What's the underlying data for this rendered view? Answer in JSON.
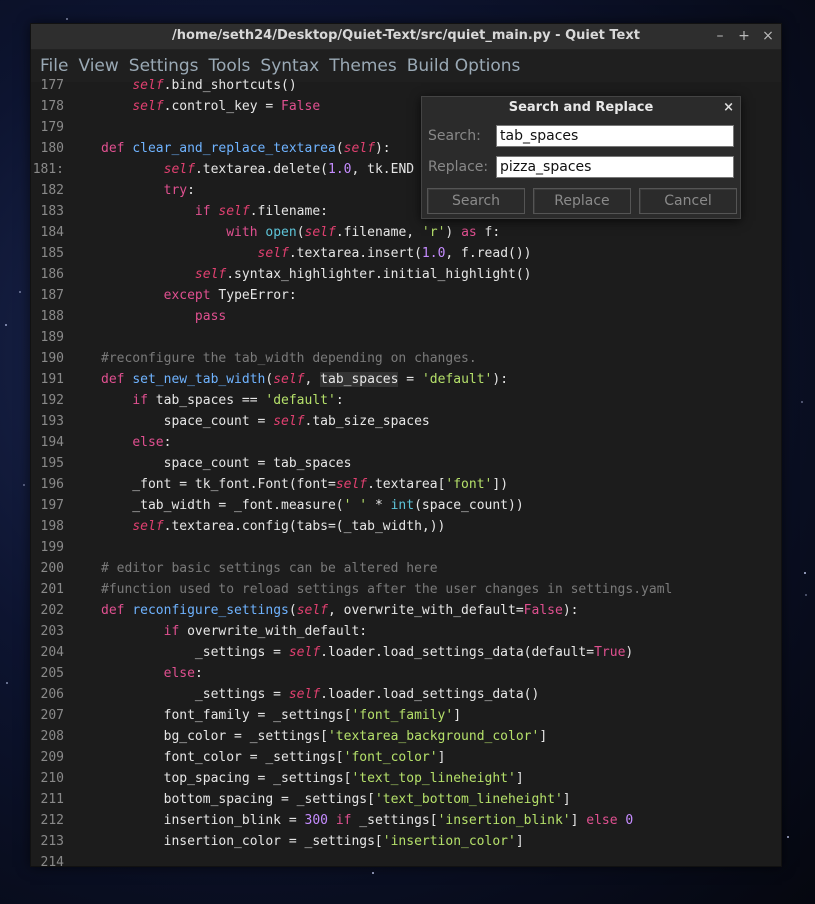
{
  "window": {
    "title": "/home/seth24/Desktop/Quiet-Text/src/quiet_main.py - Quiet Text",
    "minimize": "–",
    "maximize": "+",
    "close": "×"
  },
  "menu": [
    "File",
    "View",
    "Settings",
    "Tools",
    "Syntax",
    "Themes",
    "Build Options"
  ],
  "dialog": {
    "title": "Search and Replace",
    "close": "×",
    "search_label": "Search:",
    "search_value": "tab_spaces",
    "replace_label": "Replace:",
    "replace_value": "pizza_spaces",
    "buttons": [
      "Search",
      "Replace",
      "Cancel"
    ]
  },
  "lines": [
    {
      "n": "177",
      "html": "        <span class=\"self\">self</span>.bind_shortcuts()"
    },
    {
      "n": "178",
      "html": "        <span class=\"self\">self</span>.control_key = <span class=\"kw\">False</span>"
    },
    {
      "n": "179",
      "html": ""
    },
    {
      "n": "180",
      "html": "    <span class=\"kw\">def</span> <span class=\"fn\">clear_and_replace_textarea</span>(<span class=\"self\">self</span>):"
    },
    {
      "n": "181:",
      "html": "            <span class=\"self\">self</span>.textarea.delete(<span class=\"num\">1.0</span>, tk.END"
    },
    {
      "n": "182",
      "html": "            <span class=\"kw\">try</span>:"
    },
    {
      "n": "183",
      "html": "                <span class=\"kw\">if</span> <span class=\"self\">self</span>.filename:"
    },
    {
      "n": "184",
      "html": "                    <span class=\"kw\">with</span> <span class=\"bi\">open</span>(<span class=\"self\">self</span>.filename, <span class=\"str\">'r'</span>) <span class=\"kw\">as</span> f:"
    },
    {
      "n": "185",
      "html": "                        <span class=\"self\">self</span>.textarea.insert(<span class=\"num\">1.0</span>, f.read())"
    },
    {
      "n": "186",
      "html": "                <span class=\"self\">self</span>.syntax_highlighter.initial_highlight()"
    },
    {
      "n": "187",
      "html": "            <span class=\"kw\">except</span> TypeError:"
    },
    {
      "n": "188",
      "html": "                <span class=\"kw\">pass</span>"
    },
    {
      "n": "189",
      "html": ""
    },
    {
      "n": "190",
      "html": "    <span class=\"cm\">#reconfigure the tab_width depending on changes.</span>"
    },
    {
      "n": "191",
      "html": "    <span class=\"kw\">def</span> <span class=\"fn\">set_new_tab_width</span>(<span class=\"self\">self</span>, <span class=\"hl\">tab_spaces</span> = <span class=\"str\">'default'</span>):"
    },
    {
      "n": "192",
      "html": "        <span class=\"kw\">if</span> tab_spaces == <span class=\"str\">'default'</span>:"
    },
    {
      "n": "193",
      "html": "            space_count = <span class=\"self\">self</span>.tab_size_spaces"
    },
    {
      "n": "194",
      "html": "        <span class=\"kw\">else</span>:"
    },
    {
      "n": "195",
      "html": "            space_count = tab_spaces"
    },
    {
      "n": "196",
      "html": "        _font = tk_font.Font(font=<span class=\"self\">self</span>.textarea[<span class=\"str\">'font'</span>])"
    },
    {
      "n": "197",
      "html": "        _tab_width = _font.measure(<span class=\"str\">' '</span> * <span class=\"bi\">int</span>(space_count))"
    },
    {
      "n": "198",
      "html": "        <span class=\"self\">self</span>.textarea.config(tabs=(_tab_width,))"
    },
    {
      "n": "199",
      "html": ""
    },
    {
      "n": "200",
      "html": "    <span class=\"cm\"># editor basic settings can be altered here</span>"
    },
    {
      "n": "201",
      "html": "    <span class=\"cm\">#function used to reload settings after the user changes in settings.yaml</span>"
    },
    {
      "n": "202",
      "html": "    <span class=\"kw\">def</span> <span class=\"fn\">reconfigure_settings</span>(<span class=\"self\">self</span>, overwrite_with_default=<span class=\"kw\">False</span>):"
    },
    {
      "n": "203",
      "html": "            <span class=\"kw\">if</span> overwrite_with_default:"
    },
    {
      "n": "204",
      "html": "                _settings = <span class=\"self\">self</span>.loader.load_settings_data(default=<span class=\"kw\">True</span>)"
    },
    {
      "n": "205",
      "html": "            <span class=\"kw\">else</span>:"
    },
    {
      "n": "206",
      "html": "                _settings = <span class=\"self\">self</span>.loader.load_settings_data()"
    },
    {
      "n": "207",
      "html": "            font_family = _settings[<span class=\"str\">'font_family'</span>]"
    },
    {
      "n": "208",
      "html": "            bg_color = _settings[<span class=\"str\">'textarea_background_color'</span>]"
    },
    {
      "n": "209",
      "html": "            font_color = _settings[<span class=\"str\">'font_color'</span>]"
    },
    {
      "n": "210",
      "html": "            top_spacing = _settings[<span class=\"str\">'text_top_lineheight'</span>]"
    },
    {
      "n": "211",
      "html": "            bottom_spacing = _settings[<span class=\"str\">'text_bottom_lineheight'</span>]"
    },
    {
      "n": "212",
      "html": "            insertion_blink = <span class=\"num\">300</span> <span class=\"kw\">if</span> _settings[<span class=\"str\">'insertion_blink'</span>] <span class=\"kw\">else</span> <span class=\"num\">0</span>"
    },
    {
      "n": "213",
      "html": "            insertion_color = _settings[<span class=\"str\">'insertion_color'</span>]"
    },
    {
      "n": "214",
      "html": ""
    }
  ]
}
